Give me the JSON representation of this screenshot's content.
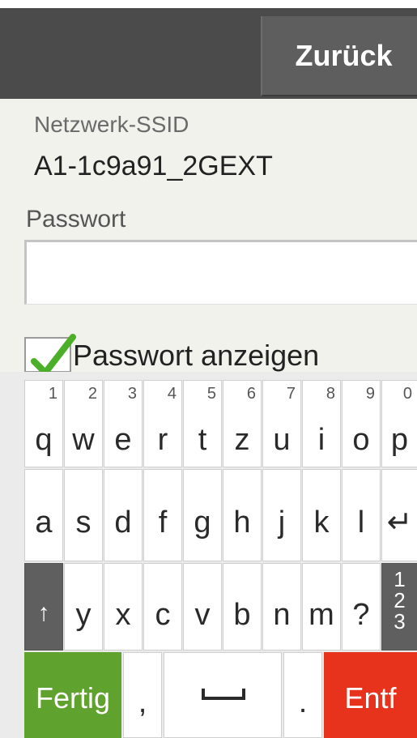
{
  "header": {
    "back_label": "Zurück"
  },
  "network": {
    "ssid_label": "Netzwerk-SSID",
    "ssid_value": "A1-1c9a91_2GEXT",
    "password_label": "Passwort",
    "password_value": "",
    "show_password_label": "Passwort anzeigen",
    "show_password_checked": true
  },
  "keyboard": {
    "row1": [
      {
        "char": "q",
        "num": "1"
      },
      {
        "char": "w",
        "num": "2"
      },
      {
        "char": "e",
        "num": "3"
      },
      {
        "char": "r",
        "num": "4"
      },
      {
        "char": "t",
        "num": "5"
      },
      {
        "char": "z",
        "num": "6"
      },
      {
        "char": "u",
        "num": "7"
      },
      {
        "char": "i",
        "num": "8"
      },
      {
        "char": "o",
        "num": "9"
      },
      {
        "char": "p",
        "num": "0"
      }
    ],
    "row2": [
      "a",
      "s",
      "d",
      "f",
      "g",
      "h",
      "j",
      "k",
      "l",
      "↵"
    ],
    "row3": [
      "↑",
      "y",
      "x",
      "c",
      "v",
      "b",
      "n",
      "m",
      "?"
    ],
    "num_toggle": [
      "1",
      "2",
      "3"
    ],
    "done_label": "Fertig",
    "comma_label": ",",
    "space_label": "⎵",
    "period_label": ".",
    "delete_label": "Entf"
  },
  "colors": {
    "header_bg": "#4b4b4b",
    "done_green": "#5fa22e",
    "delete_red": "#e7331c",
    "check_green": "#4caf2a"
  }
}
